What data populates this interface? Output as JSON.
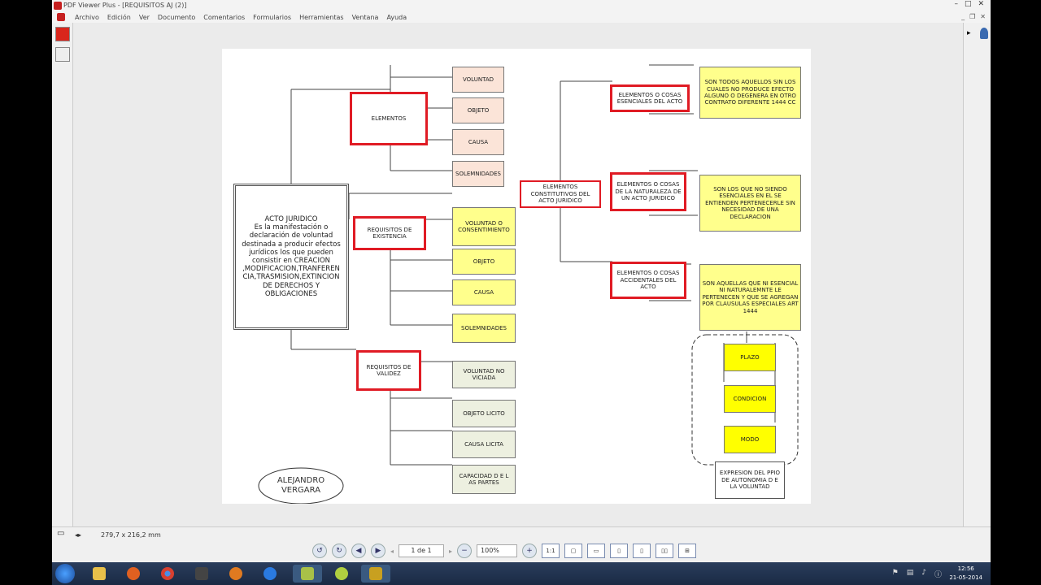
{
  "window": {
    "title": "PDF Viewer Plus - [REQUISITOS AJ (2)]"
  },
  "menu": [
    "Archivo",
    "Edición",
    "Ver",
    "Documento",
    "Comentarios",
    "Formularios",
    "Herramientas",
    "Ventana",
    "Ayuda"
  ],
  "diagram": {
    "main": "ACTO JURIDICO\nEs la manifestación o declaración de voluntad destinada a producir efectos jurídicos los que pueden consistir en CREACION ,MODIFICACION,TRANFEREN CIA,TRASMISION,EXTINCION DE DERECHOS Y OBLIGACIONES",
    "elementos": "ELEMENTOS",
    "elementos_items": [
      "VOLUNTAD",
      "OBJETO",
      "CAUSA",
      "SOLEMNIDADES"
    ],
    "existencia": "REQUISITOS DE EXISTENCIA",
    "existencia_items": [
      "VOLUNTAD O CONSENTIMIENTO",
      "OBJETO",
      "CAUSA",
      "SOLEMNIDADES"
    ],
    "validez": "REQUISITOS DE VALIDEZ",
    "validez_items": [
      "VOLUNTAD NO VICIADA",
      "OBJETO LICITO",
      "CAUSA LICITA",
      "CAPACIDAD D E L AS PARTES"
    ],
    "constitutivos": "ELEMENTOS CONSTITUTIVOS DEL ACTO JURIDICO",
    "esenciales": "ELEMENTOS O COSAS ESENCIALES DEL ACTO",
    "esenciales_desc": "SON TODOS AQUELLOS SIN LOS CUALES NO PRODUCE EFECTO ALGUNO O DEGENERA EN OTRO CONTRATO DIFERENTE 1444 CC",
    "naturaleza": "ELEMENTOS O COSAS DE LA NATURALEZA DE UN ACTO JURIDICO",
    "naturaleza_desc": "SON LOS QUE NO SIENDO ESENCIALES EN EL SE ENTIENDEN PERTENECERLE SIN NECESIDAD DE UNA DECLARACION",
    "accidentales": "ELEMENTOS O COSAS ACCIDENTALES DEL ACTO",
    "accidentales_desc": "SON AQUELLAS QUE NI ESENCIAL NI NATURALEMNTE LE PERTENECEN Y QUE SE AGREGAN POR CLAUSULAS ESPECIALES ART 1444",
    "modalidades": [
      "PLAZO",
      "CONDICION",
      "MODO"
    ],
    "autonomia": "EXPRESION DEL PPIO DE AUTONOMIA D E LA VOLUNTAD",
    "author": "ALEJANDRO VERGARA"
  },
  "status": {
    "page_size": "279,7 x 216,2 mm",
    "page_indicator": "1 de 1",
    "zoom": "100%"
  },
  "clock": {
    "time": "12:56",
    "date": "21-05-2014"
  }
}
